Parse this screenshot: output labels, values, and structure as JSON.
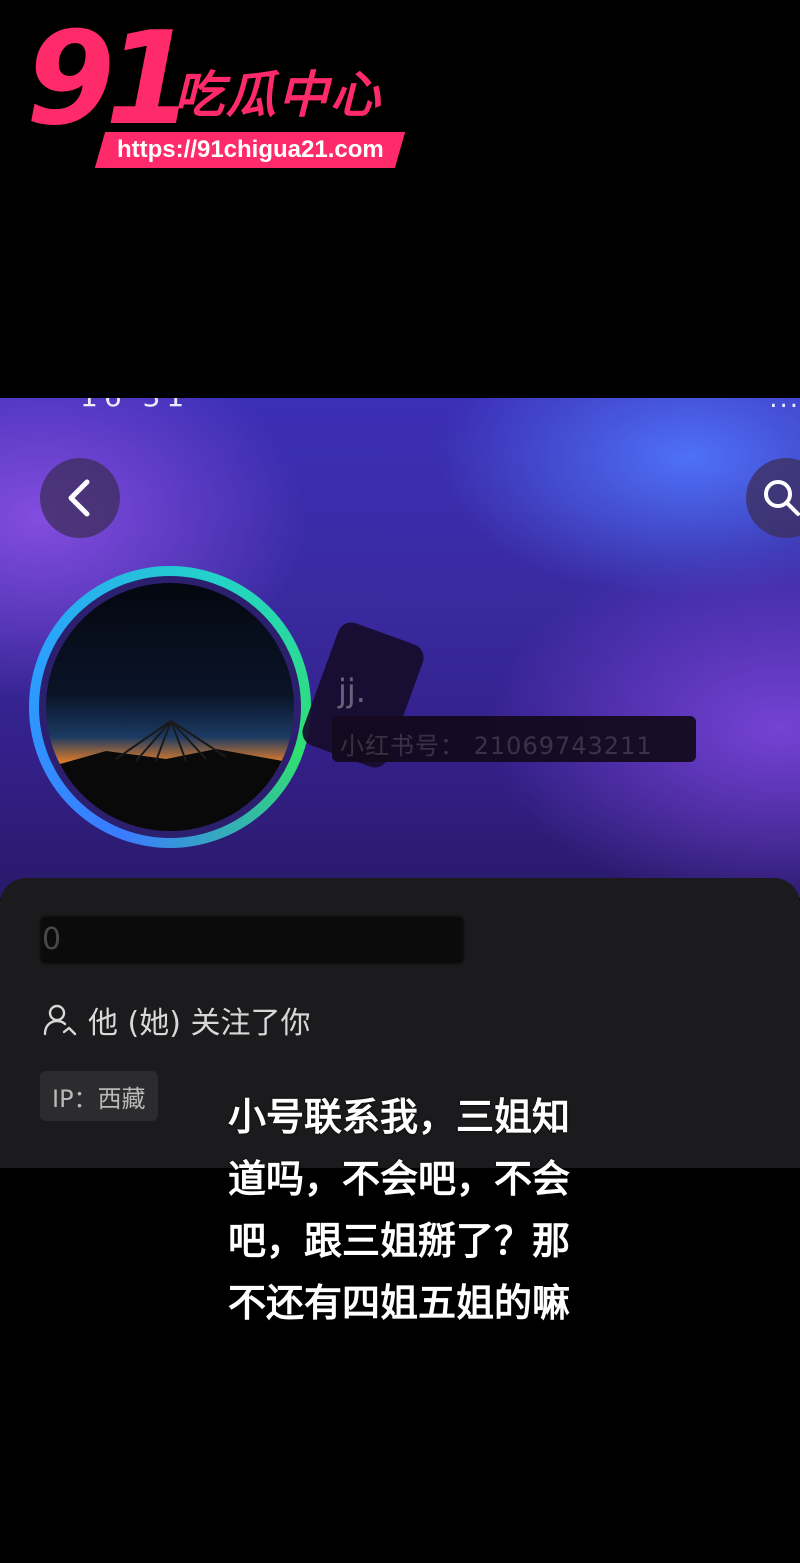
{
  "watermark": {
    "number": "91",
    "name": "吃瓜中心",
    "url": "https://91chigua21.com"
  },
  "status_bar": {
    "time_partial": "16 31",
    "right_partial": "..."
  },
  "profile": {
    "name_partial": "jj.",
    "id_label": "小红书号",
    "id_value": "21069743211",
    "signature_partial": "0",
    "follow_status": "他 (她) 关注了你",
    "ip_label": "IP：",
    "ip_value": "西藏"
  },
  "caption": {
    "lines": [
      "小号联系我，三姐知",
      "道吗，不会吧，不会",
      "吧，跟三姐掰了？那",
      "不还有四姐五姐的嘛"
    ]
  },
  "icons": {
    "back": "chevron-left-icon",
    "search": "search-icon",
    "follow": "user-follow-icon"
  },
  "colors": {
    "brand": "#ff2a6a",
    "banner": "#3a2aa0",
    "card": "#1b1b1d"
  }
}
